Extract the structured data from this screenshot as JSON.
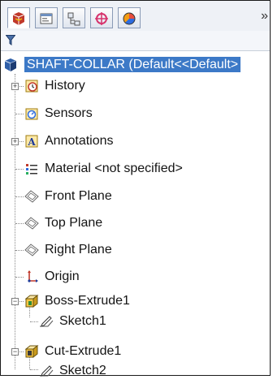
{
  "panel": {
    "tabs": [
      {
        "icon": "featuremanager-icon"
      },
      {
        "icon": "propertymanager-icon"
      },
      {
        "icon": "configurationmanager-icon"
      },
      {
        "icon": "dimxpert-icon"
      },
      {
        "icon": "display-manager-icon"
      }
    ],
    "more_label": "»",
    "filter_icon": "filter-icon"
  },
  "tree": {
    "root": "SHAFT-COLLAR  (Default<<Default>",
    "items": [
      {
        "label": "History",
        "icon": "history-icon",
        "expander": "+"
      },
      {
        "label": "Sensors",
        "icon": "sensors-icon"
      },
      {
        "label": "Annotations",
        "icon": "annotations-icon",
        "expander": "+"
      },
      {
        "label": "Material <not specified>",
        "icon": "material-icon"
      },
      {
        "label": "Front Plane",
        "icon": "plane-icon"
      },
      {
        "label": "Top Plane",
        "icon": "plane-icon"
      },
      {
        "label": "Right Plane",
        "icon": "plane-icon"
      },
      {
        "label": "Origin",
        "icon": "origin-icon"
      },
      {
        "label": "Boss-Extrude1",
        "icon": "boss-extrude-icon",
        "expander": "−"
      },
      {
        "label": "Sketch1",
        "icon": "sketch-icon"
      },
      {
        "label": "Cut-Extrude1",
        "icon": "cut-extrude-icon",
        "expander": "−"
      },
      {
        "label": "Sketch2",
        "icon": "sketch-icon"
      }
    ]
  },
  "colors": {
    "selection": "#3c79c7",
    "frame": "#1a1a1a"
  }
}
